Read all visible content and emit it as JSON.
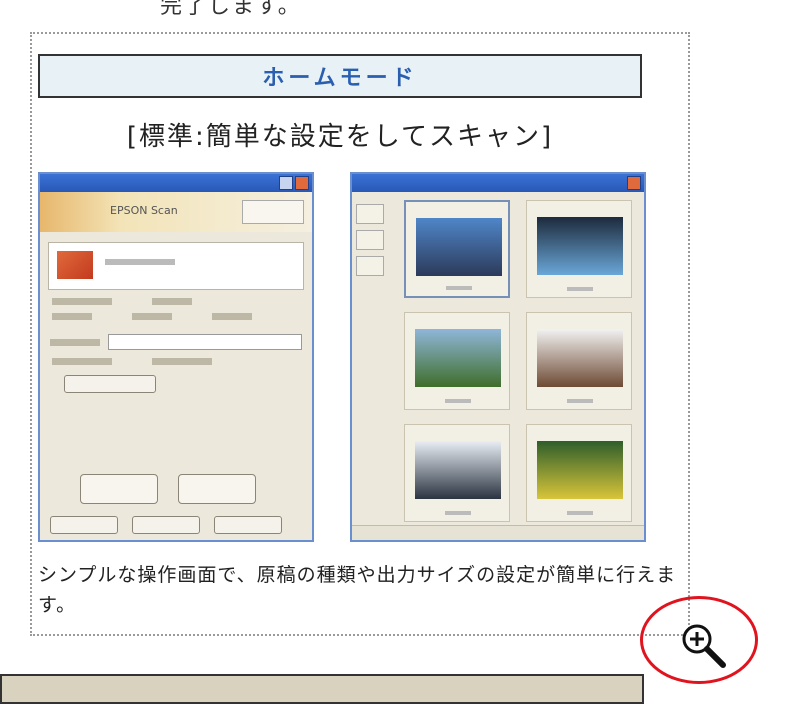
{
  "top_fragment": "完了します。",
  "card": {
    "mode_title": "ホームモード",
    "subtitle": "[標準:簡単な設定をしてスキャン]",
    "caption": "シンプルな操作画面で、原稿の種類や出力サイズの設定が簡単に行えます。"
  },
  "left_screenshot": {
    "brand": "EPSON Scan"
  },
  "thumbnails": [
    {
      "name": "sky-field",
      "selected": true,
      "colors": [
        "#4f86c8",
        "#2c3a5a"
      ]
    },
    {
      "name": "waterfall",
      "selected": false,
      "colors": [
        "#1d2b3c",
        "#6aa6d8"
      ]
    },
    {
      "name": "grass-field",
      "selected": false,
      "colors": [
        "#8fb6d8",
        "#3f6e2a"
      ]
    },
    {
      "name": "clouds",
      "selected": false,
      "colors": [
        "#f2f2f2",
        "#6e4a34"
      ]
    },
    {
      "name": "misty-waterfall",
      "selected": false,
      "colors": [
        "#e8eef4",
        "#2a3340"
      ]
    },
    {
      "name": "yellow-flowers",
      "selected": false,
      "colors": [
        "#2e5e2a",
        "#d8c53a"
      ]
    }
  ],
  "icons": {
    "zoom": "zoom-in-magnifier-icon"
  },
  "colors": {
    "accent_red": "#e0141e",
    "mode_title": "#2a5fb0"
  }
}
